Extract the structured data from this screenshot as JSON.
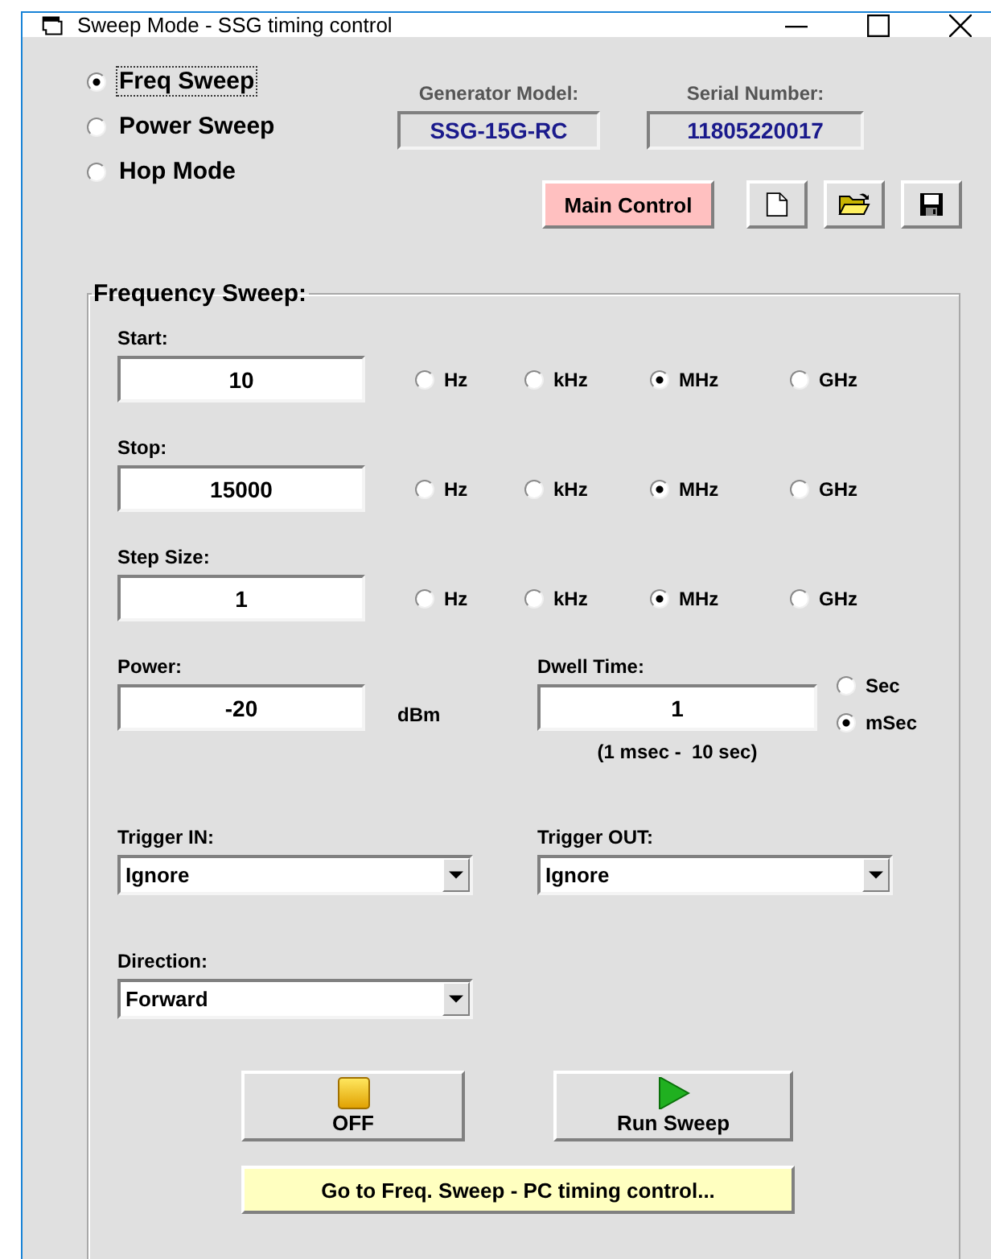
{
  "window": {
    "title": "Sweep Mode - SSG timing control"
  },
  "modes": [
    {
      "label": "Freq Sweep",
      "selected": true
    },
    {
      "label": "Power Sweep",
      "selected": false
    },
    {
      "label": "Hop Mode",
      "selected": false
    }
  ],
  "generator_model": {
    "label": "Generator Model:",
    "value": "SSG-15G-RC"
  },
  "serial_number": {
    "label": "Serial Number:",
    "value": "11805220017"
  },
  "main_control": "Main Control",
  "sweep": {
    "title": "Frequency Sweep:",
    "freq_fields": [
      {
        "label": "Start:",
        "value": "10",
        "units": [
          {
            "label": "Hz",
            "selected": false
          },
          {
            "label": "kHz",
            "selected": false
          },
          {
            "label": "MHz",
            "selected": true
          },
          {
            "label": "GHz",
            "selected": false
          }
        ]
      },
      {
        "label": "Stop:",
        "value": "15000",
        "units": [
          {
            "label": "Hz",
            "selected": false
          },
          {
            "label": "kHz",
            "selected": false
          },
          {
            "label": "MHz",
            "selected": true
          },
          {
            "label": "GHz",
            "selected": false
          }
        ]
      },
      {
        "label": "Step Size:",
        "value": "1",
        "units": [
          {
            "label": "Hz",
            "selected": false
          },
          {
            "label": "kHz",
            "selected": false
          },
          {
            "label": "MHz",
            "selected": true
          },
          {
            "label": "GHz",
            "selected": false
          }
        ]
      }
    ],
    "power": {
      "label": "Power:",
      "value": "-20",
      "unit": "dBm"
    },
    "dwell": {
      "label": "Dwell Time:",
      "value": "1",
      "range": "(1 msec -  10 sec)",
      "units": [
        {
          "label": "Sec",
          "selected": false
        },
        {
          "label": "mSec",
          "selected": true
        }
      ]
    },
    "trigger_in": {
      "label": "Trigger IN:",
      "value": "Ignore"
    },
    "trigger_out": {
      "label": "Trigger OUT:",
      "value": "Ignore"
    },
    "direction": {
      "label": "Direction:",
      "value": "Forward"
    },
    "off_button": "OFF",
    "run_button": "Run Sweep",
    "pc_timing_button": "Go to Freq. Sweep - PC timing control..."
  }
}
